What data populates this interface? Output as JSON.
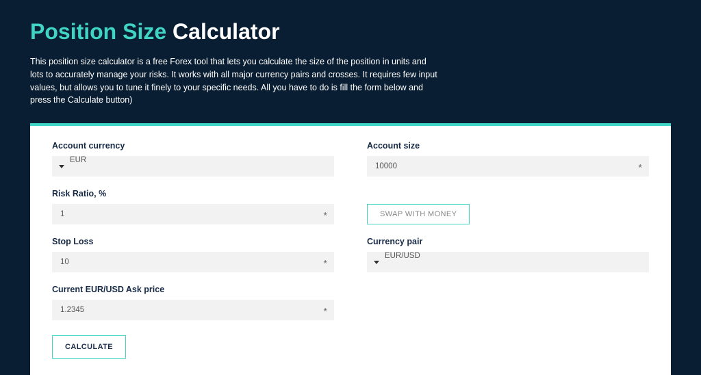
{
  "header": {
    "title_accent": "Position Size",
    "title_rest": "Calculator",
    "description": "This position size calculator is a free Forex tool that lets you calculate the size of the position in units and lots to accurately manage your risks. It works with all major currency pairs and crosses. It requires few input values, but allows you to tune it finely to your specific needs. All you have to do is fill the form below and press the Calculate button)"
  },
  "form": {
    "account_currency": {
      "label": "Account currency",
      "value": "EUR"
    },
    "account_size": {
      "label": "Account size",
      "value": "10000"
    },
    "risk_ratio": {
      "label": "Risk Ratio, %",
      "value": "1"
    },
    "swap_button_label": "SWAP WITH MONEY",
    "stop_loss": {
      "label": "Stop Loss",
      "value": "10"
    },
    "currency_pair": {
      "label": "Currency pair",
      "value": "EUR/USD"
    },
    "ask_price": {
      "label": "Current EUR/USD Ask price",
      "value": "1.2345"
    },
    "calculate_button_label": "CALCULATE"
  },
  "colors": {
    "accent": "#3fd4c4",
    "bg": "#0a1e33"
  }
}
